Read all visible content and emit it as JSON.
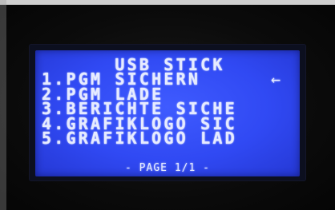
{
  "screen": {
    "title": "USB STICK",
    "menu_items": [
      "1.PGM SICHERN",
      "2.PGM LADE",
      "3.BERICHTE SICHE",
      "4.GRAFIKLOGO SIC",
      "5.GRAFIKLOGO LAD"
    ],
    "selection_marker": "←",
    "selected_index": 0,
    "footer": "- PAGE 1/1 -"
  },
  "colors": {
    "lcd_background": "#3049f3",
    "lcd_text": "#e6ebff",
    "bezel": "#0c0f1f"
  }
}
